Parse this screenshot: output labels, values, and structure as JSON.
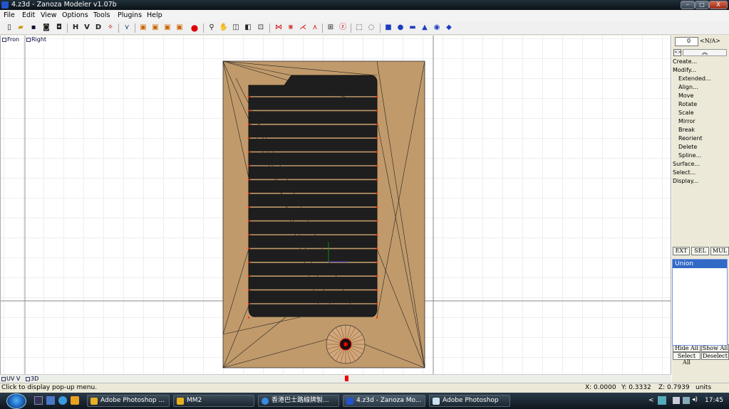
{
  "window": {
    "title": "4.z3d - Zanoza Modeler v1.07b",
    "min": "–",
    "max": "□",
    "close": "X"
  },
  "menu": [
    "File",
    "Edit",
    "View",
    "Options",
    "Tools",
    "Plugins",
    "Help"
  ],
  "toolbar": {
    "h": "H",
    "v": "V",
    "d": "D"
  },
  "viewports": {
    "front": "Fron",
    "right": "Right",
    "uv": "UV V",
    "three_d": "3D"
  },
  "panel": {
    "spinner_value": "0",
    "dropdown": "<N/A>",
    "collapse": "<>",
    "items": [
      "Create...",
      "Modify...",
      "Extended...",
      "Align...",
      "Move",
      "Rotate",
      "Scale",
      "Mirror",
      "Break",
      "Reorient",
      "Delete",
      "Spline...",
      "Surface...",
      "Select...",
      "Display..."
    ],
    "mode_buttons": [
      "EXT",
      "SEL",
      "MUL"
    ],
    "list": [
      "Union"
    ],
    "bottom_buttons": [
      "Hide All",
      "Show All",
      "Select All",
      "Deselect"
    ]
  },
  "status": {
    "hint": "Click to display pop-up menu.",
    "x": "X: 0.0000",
    "y": "Y: 0.3332",
    "z": "Z: 0.7939",
    "units": "units"
  },
  "taskbar": {
    "tasks": [
      "Adobe Photoshop ...",
      "MM2",
      "香港巴士路線牌製...",
      "4.z3d - Zanoza Mo...",
      "Adobe Photoshop"
    ],
    "clock": "17:45",
    "chev": "<"
  },
  "colors": {
    "tan": "#c19a6b",
    "slot": "#1e1e1e",
    "accent": "#3169c6",
    "vertex": "#ff0000"
  }
}
